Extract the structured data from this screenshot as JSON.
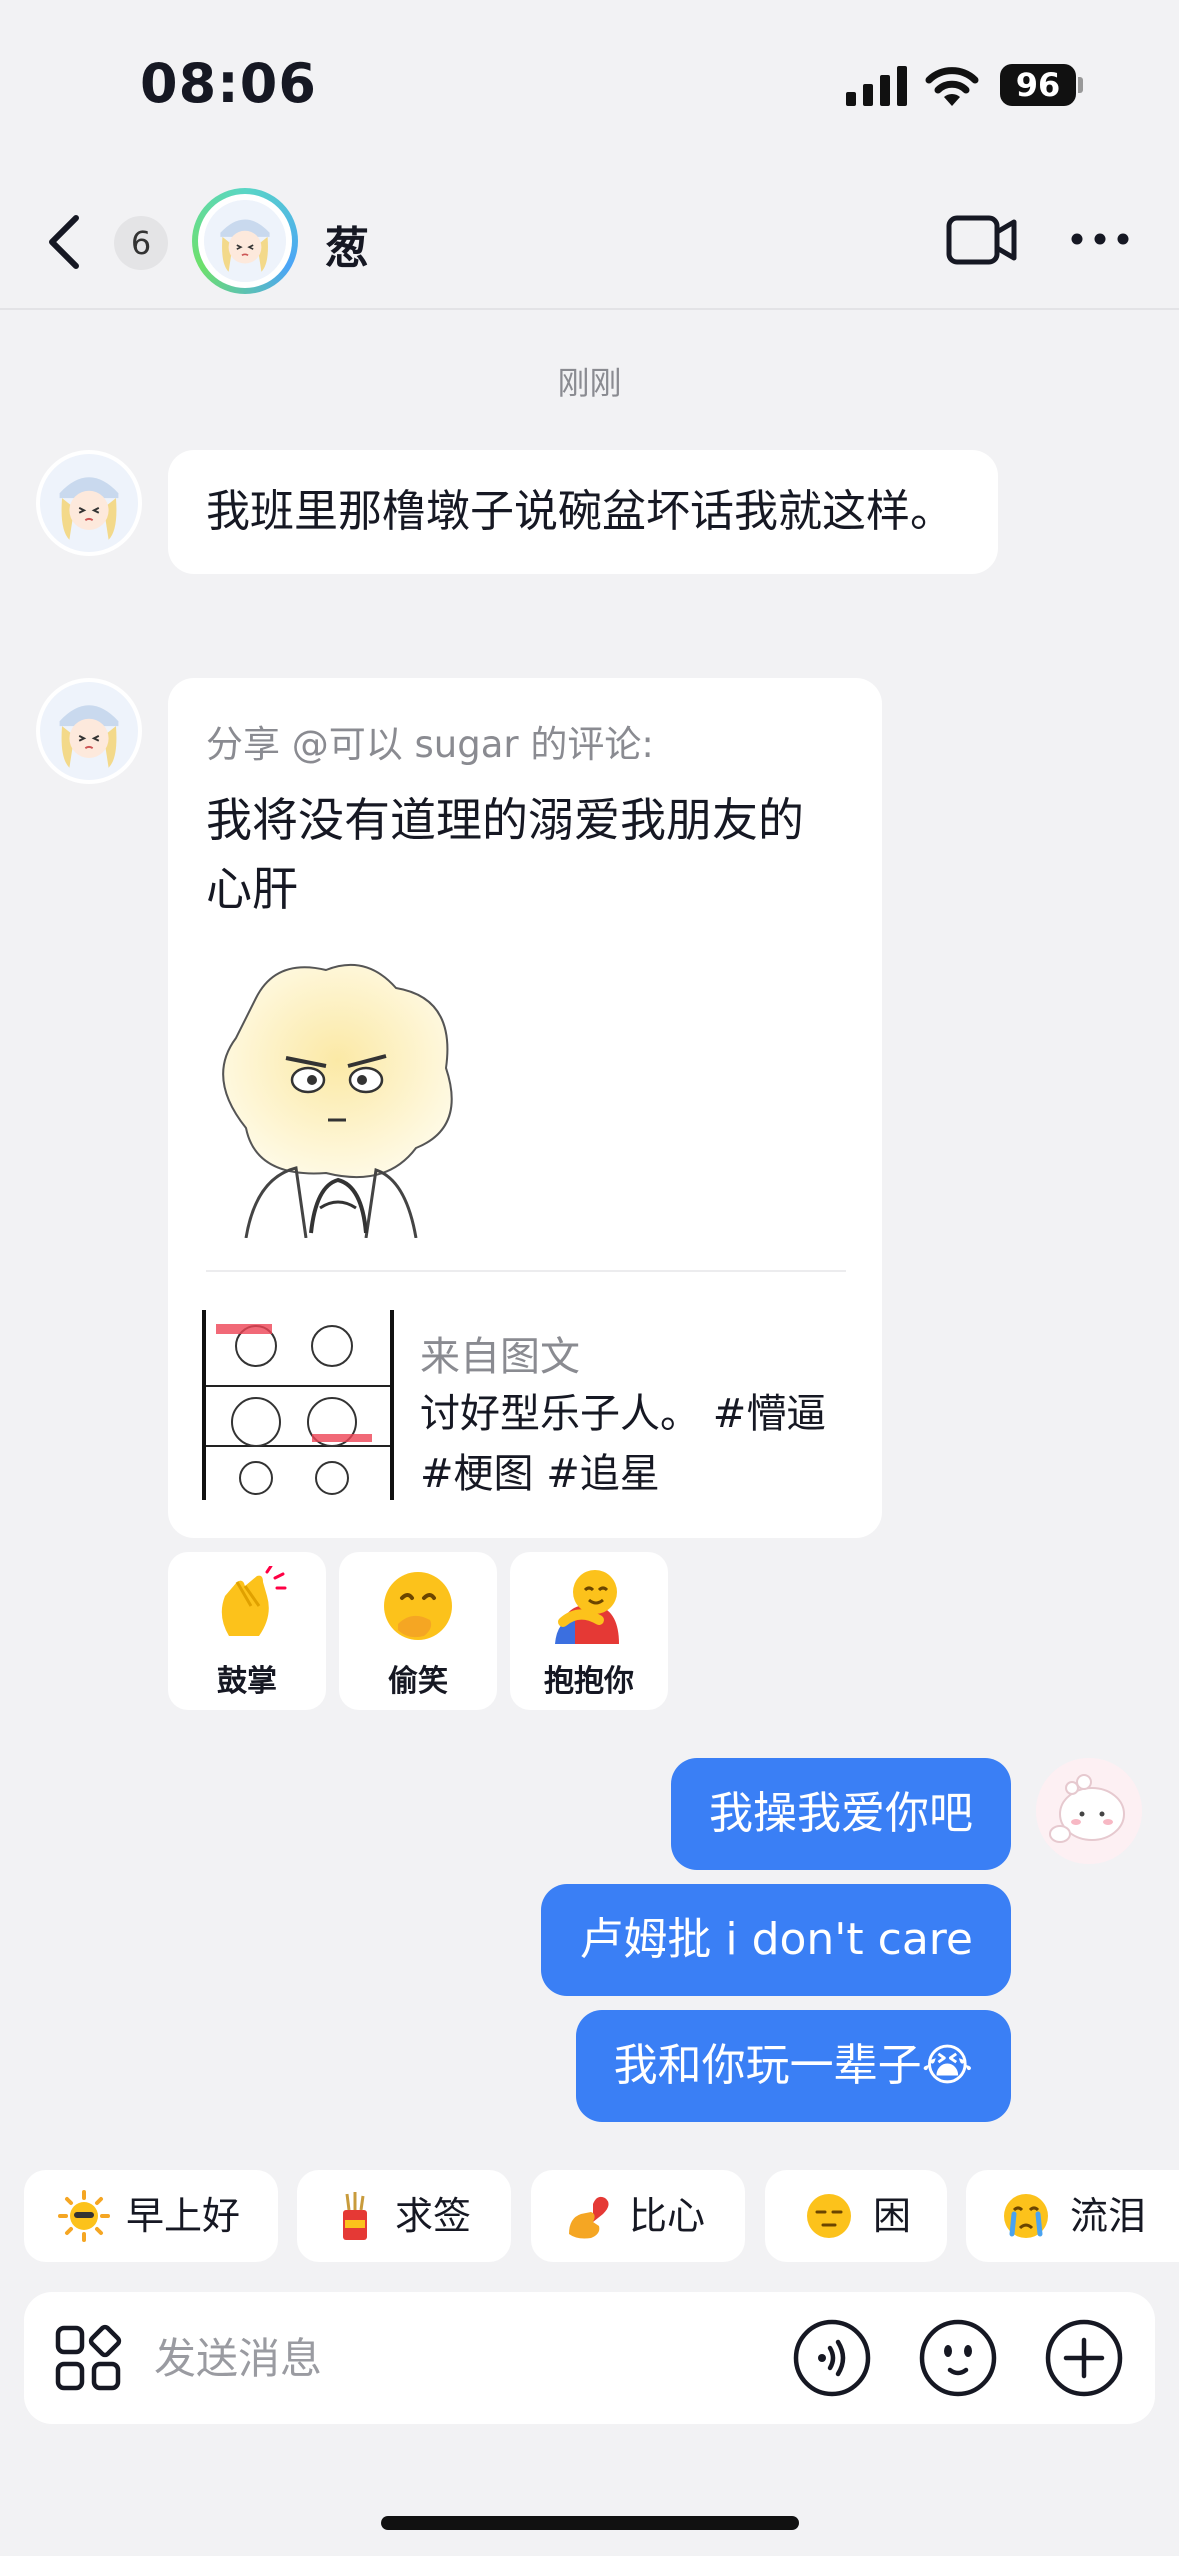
{
  "status_bar": {
    "time": "08:06",
    "battery": "96"
  },
  "header": {
    "unread_count": "6",
    "contact_name": "葱"
  },
  "timestamp": "刚刚",
  "messages": {
    "m1": "我班里那橹墩子说碗盆坏话我就这样。",
    "share": {
      "from": "分享 @可以 sugar 的评论:",
      "text": "我将没有道理的溺爱我朋友的心肝",
      "source_label": "来自图文",
      "source_desc": "讨好型乐子人。 #懵逼 #梗图 #追星"
    },
    "reactions": [
      {
        "label": "鼓掌",
        "icon": "clap-icon"
      },
      {
        "label": "偷笑",
        "icon": "snicker-icon"
      },
      {
        "label": "抱抱你",
        "icon": "hug-icon"
      }
    ],
    "outgoing": [
      "我操我爱你吧",
      "卢姆批 i don't care",
      "我和你玩一辈子😭"
    ]
  },
  "quick_replies": [
    {
      "label": "早上好",
      "icon": "sun-icon"
    },
    {
      "label": "求签",
      "icon": "fortune-icon"
    },
    {
      "label": "比心",
      "icon": "heart-hand-icon"
    },
    {
      "label": "困",
      "icon": "sleepy-icon"
    },
    {
      "label": "流泪",
      "icon": "crying-icon"
    }
  ],
  "input": {
    "placeholder": "发送消息"
  },
  "colors": {
    "accent": "#3a7ff5",
    "background": "#f2f2f4"
  }
}
